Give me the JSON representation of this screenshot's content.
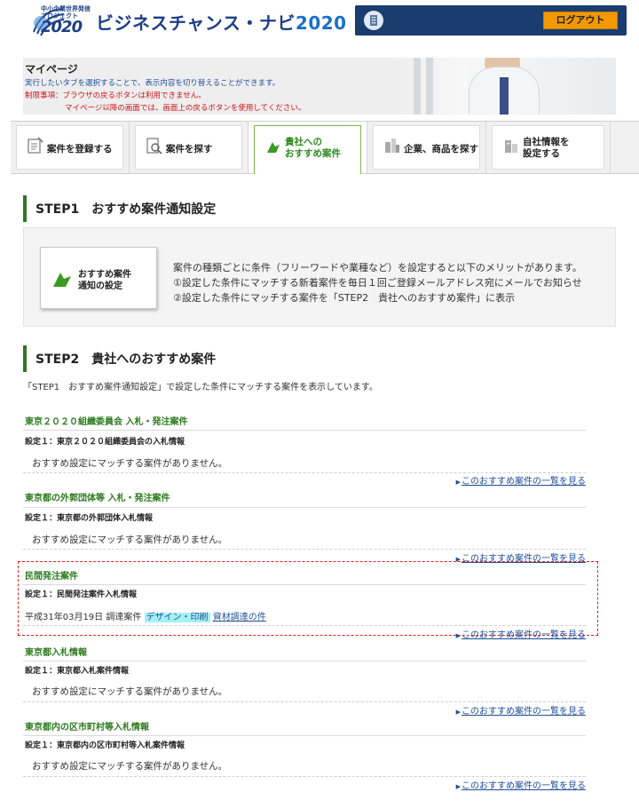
{
  "header": {
    "logo_small_text": "中小企業世界発信\nプロジェクト",
    "logo_year": "2020",
    "title_main": "ビジネスチャンス・ナビ",
    "title_year": "2020",
    "logout_label": "ログアウト"
  },
  "mypage": {
    "title": "マイページ",
    "description": "実行したいタブを選択することで、表示内容を切り替えることができます。",
    "warning_line1": "制限事項：ブラウザの戻るボタンは利用できません。",
    "warning_line2": "マイページ以降の画面では、画面上の戻るボタンを使用してください。"
  },
  "tabs": [
    {
      "label": "案件を登録する"
    },
    {
      "label": "案件を探す"
    },
    {
      "label": "貴社への\nおすすめ案件",
      "active": true
    },
    {
      "label": "企業、商品を探す"
    },
    {
      "label": "自社情報を\n設定する"
    }
  ],
  "step1": {
    "heading": "STEP1　おすすめ案件通知設定",
    "button_label": "おすすめ案件\n通知の設定",
    "text_line1": "案件の種類ごとに条件（フリーワードや業種など）を設定すると以下のメリットがあります。",
    "text_line2": "①設定した条件にマッチする新着案件を毎日１回ご登録メールアドレス宛にメールでお知らせ",
    "text_line3": "②設定した条件にマッチする案件を「STEP2　貴社へのおすすめ案件」に表示"
  },
  "step2": {
    "heading": "STEP2　貴社へのおすすめ案件",
    "description": "「STEP1　おすすめ案件通知設定」で設定した条件にマッチする案件を表示しています。",
    "view_all_label": "このおすすめ案件の一覧を見る",
    "categories": [
      {
        "title": "東京２０２０組織委員会 入札・発注案件",
        "setting": "設定１：東京２０２０組織委員会の入札情報",
        "message": "おすすめ設定にマッチする案件がありません。"
      },
      {
        "title": "東京都の外郭団体等 入札・発注案件",
        "setting": "設定１：東京都の外郭団体入札情報",
        "message": "おすすめ設定にマッチする案件がありません。"
      },
      {
        "title": "民間発注案件",
        "setting": "設定１：民間発注案件入札情報",
        "entry": {
          "date": "平成31年03月19日",
          "type": "調達案件",
          "tag": "デザイン・印刷",
          "link": "資材調達の件"
        }
      },
      {
        "title": "東京都入札情報",
        "setting": "設定１：東京都入札案件情報",
        "message": "おすすめ設定にマッチする案件がありません。"
      },
      {
        "title": "東京都内の区市町村等入札情報",
        "setting": "設定１：東京都内の区市町村等入札案件情報",
        "message": "おすすめ設定にマッチする案件がありません。"
      }
    ]
  },
  "colors": {
    "brand_navy": "#1a3c6e",
    "accent_green": "#2d7a1e",
    "logout_orange": "#f39800",
    "link_blue": "#1f4e9a",
    "warning_red": "#d0121b",
    "tag_cyan": "#a6f0f5"
  },
  "icons": [
    "logo-globe-icon",
    "building-icon",
    "register-icon",
    "search-doc-icon",
    "recommend-arrow-icon",
    "products-icon",
    "company-settings-icon"
  ]
}
